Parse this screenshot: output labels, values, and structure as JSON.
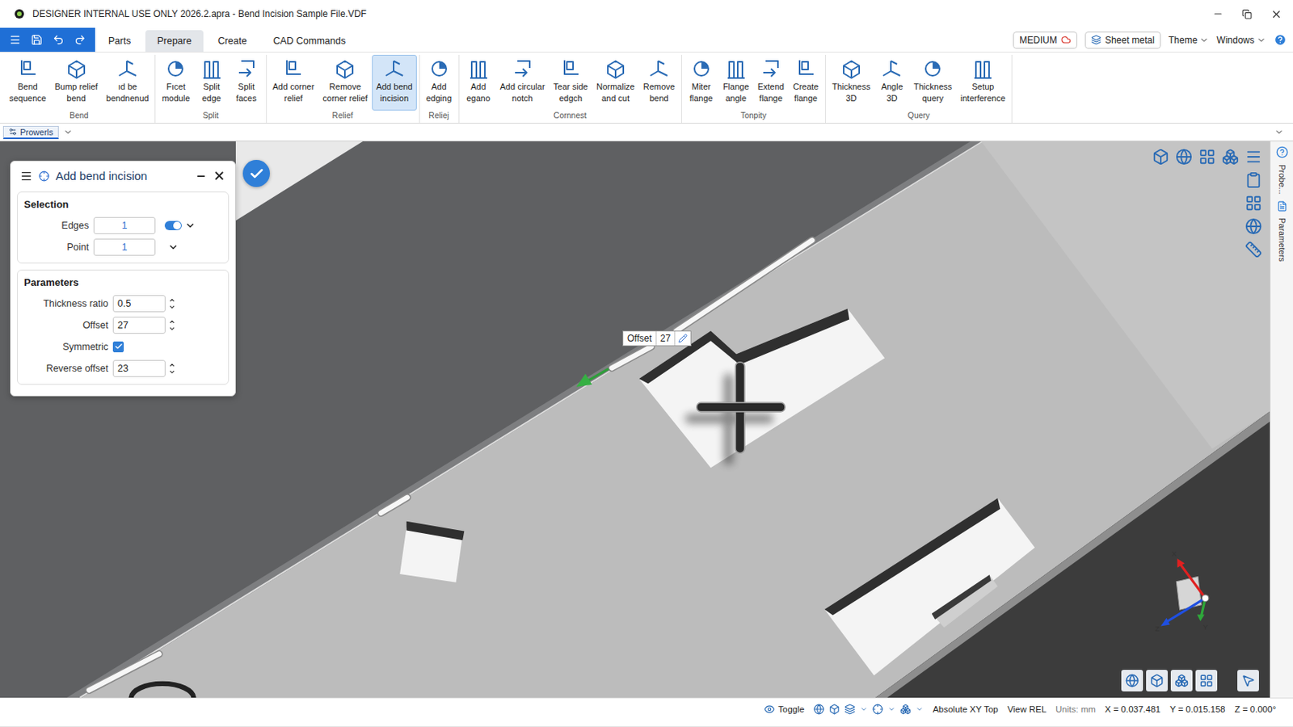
{
  "window": {
    "title": "DESIGNER INTERNAL USE ONLY 2026.2.apra - Bend Incision Sample File.VDF"
  },
  "tabs": [
    {
      "label": "Parts",
      "selected": false
    },
    {
      "label": "Prepare",
      "selected": true
    },
    {
      "label": "Create",
      "selected": false
    },
    {
      "label": "CAD Commands",
      "selected": false
    }
  ],
  "header_right": {
    "mode": "MEDIUM",
    "module": "Sheet metal",
    "menus": [
      "Theme",
      "Windows"
    ]
  },
  "ribbon": {
    "groups": [
      {
        "label": "Bend",
        "buttons": [
          {
            "lines": [
              "Bend",
              "sequence"
            ],
            "selected": false
          },
          {
            "lines": [
              "Bump relief",
              "bend"
            ],
            "selected": false
          },
          {
            "lines": [
              "ıd be",
              "bendnenud"
            ],
            "selected": false
          }
        ]
      },
      {
        "label": "Split",
        "buttons": [
          {
            "lines": [
              "Fıcet",
              "module"
            ],
            "selected": false
          },
          {
            "lines": [
              "Split",
              "edge"
            ],
            "selected": false
          },
          {
            "lines": [
              "Split",
              "faces"
            ],
            "selected": false
          }
        ]
      },
      {
        "label": "Relief",
        "buttons": [
          {
            "lines": [
              "Add corner",
              "relief"
            ],
            "selected": false
          },
          {
            "lines": [
              "Remove",
              "corner relief"
            ],
            "selected": false
          },
          {
            "lines": [
              "Add bend",
              "incision"
            ],
            "selected": true
          }
        ]
      },
      {
        "label": "Reliej",
        "buttons": [
          {
            "lines": [
              "Add",
              "edging"
            ],
            "selected": false
          }
        ]
      },
      {
        "label": "Cornnest",
        "buttons": [
          {
            "lines": [
              "Add",
              "egano"
            ],
            "selected": false
          },
          {
            "lines": [
              "Add circular",
              "notch"
            ],
            "selected": false
          },
          {
            "lines": [
              "Tear side",
              "edgch"
            ],
            "selected": false
          },
          {
            "lines": [
              "Normalize",
              "and cut"
            ],
            "selected": false
          },
          {
            "lines": [
              "Remove",
              "bend"
            ],
            "selected": false
          }
        ]
      },
      {
        "label": "Tonpity",
        "buttons": [
          {
            "lines": [
              "Miter",
              "flange"
            ],
            "selected": false
          },
          {
            "lines": [
              "Flange",
              "angle"
            ],
            "selected": false
          },
          {
            "lines": [
              "Extend",
              "flange"
            ],
            "selected": false
          },
          {
            "lines": [
              "Create",
              "flange"
            ],
            "selected": false
          }
        ]
      },
      {
        "label": "Query",
        "buttons": [
          {
            "lines": [
              "Thickness",
              "3D"
            ],
            "selected": false
          },
          {
            "lines": [
              "Angle",
              "3D"
            ],
            "selected": false
          },
          {
            "lines": [
              "Thickness",
              "query"
            ],
            "selected": false
          },
          {
            "lines": [
              "Setup",
              "interference"
            ],
            "selected": false
          }
        ]
      }
    ]
  },
  "properties_tab": {
    "label": "Prowerls"
  },
  "panel": {
    "title": "Add bend incision",
    "sections": [
      {
        "title": "Selection",
        "rows": [
          {
            "kind": "toggle-select",
            "label": "Edges",
            "value": "1",
            "on": true
          },
          {
            "kind": "select",
            "label": "Point",
            "value": "1"
          }
        ]
      },
      {
        "title": "Parameters",
        "rows": [
          {
            "kind": "spin",
            "label": "Thickness ratio",
            "value": "0.5"
          },
          {
            "kind": "spin",
            "label": "Offset",
            "value": "27"
          },
          {
            "kind": "checkbox",
            "label": "Symmetric",
            "checked": true
          },
          {
            "kind": "spin",
            "label": "Reverse offset",
            "value": "23"
          }
        ]
      }
    ]
  },
  "tooltip": {
    "label": "Offset",
    "value": "27"
  },
  "axes": [
    "X",
    "Y",
    "Z"
  ],
  "right_strip": [
    "Probe...",
    "Parameters"
  ],
  "status_bar": {
    "toggle": "Toggle",
    "items": [
      "Absolute XY Top",
      "View REL"
    ],
    "units": "Units: mm",
    "coords": [
      "X = 0.037.481",
      "Y = 0.015.158",
      "Z = 0.000°"
    ]
  }
}
